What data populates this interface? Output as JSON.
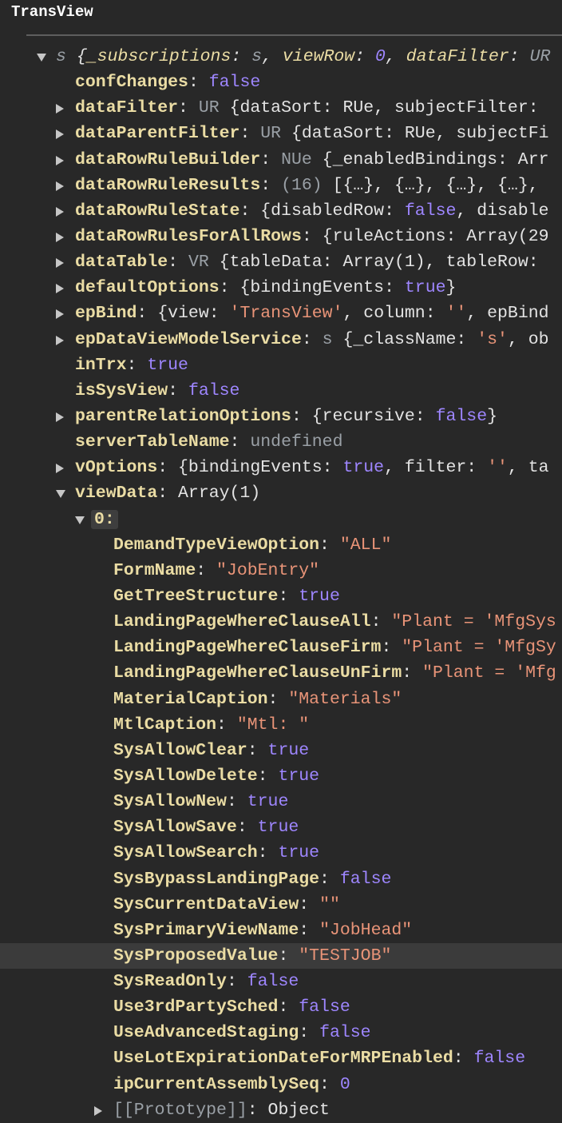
{
  "title": "TransView",
  "rows": [
    {
      "level": 0,
      "arrow": "d",
      "segs": [
        [
          "gi",
          "s "
        ],
        [
          "pi",
          "{"
        ],
        [
          "ik",
          "_subscriptions"
        ],
        [
          "pi",
          ": "
        ],
        [
          "gi",
          "s"
        ],
        [
          "pi",
          ", "
        ],
        [
          "ik",
          "viewRow"
        ],
        [
          "pi",
          ": "
        ],
        [
          "bi",
          "0"
        ],
        [
          "pi",
          ", "
        ],
        [
          "ik",
          "dataFilter"
        ],
        [
          "pi",
          ": "
        ],
        [
          "gi",
          "UR"
        ]
      ]
    },
    {
      "level": 1,
      "arrow": "",
      "segs": [
        [
          "k",
          "confChanges"
        ],
        [
          "p",
          ": "
        ],
        [
          "b",
          "false"
        ]
      ]
    },
    {
      "level": 1,
      "arrow": "r",
      "segs": [
        [
          "k",
          "dataFilter"
        ],
        [
          "p",
          ": "
        ],
        [
          "g",
          "UR "
        ],
        [
          "p",
          "{dataSort: RUe, subjectFilter: "
        ]
      ]
    },
    {
      "level": 1,
      "arrow": "r",
      "segs": [
        [
          "k",
          "dataParentFilter"
        ],
        [
          "p",
          ": "
        ],
        [
          "g",
          "UR "
        ],
        [
          "p",
          "{dataSort: RUe, subjectFi"
        ]
      ]
    },
    {
      "level": 1,
      "arrow": "r",
      "segs": [
        [
          "k",
          "dataRowRuleBuilder"
        ],
        [
          "p",
          ": "
        ],
        [
          "g",
          "NUe "
        ],
        [
          "p",
          "{_enabledBindings: Arr"
        ]
      ]
    },
    {
      "level": 1,
      "arrow": "r",
      "segs": [
        [
          "k",
          "dataRowRuleResults"
        ],
        [
          "p",
          ": "
        ],
        [
          "g",
          "(16) "
        ],
        [
          "p",
          "[{…}, {…}, {…}, {…}, "
        ]
      ]
    },
    {
      "level": 1,
      "arrow": "r",
      "segs": [
        [
          "k",
          "dataRowRuleState"
        ],
        [
          "p",
          ": {disabledRow: "
        ],
        [
          "b",
          "false"
        ],
        [
          "p",
          ", disable"
        ]
      ]
    },
    {
      "level": 1,
      "arrow": "r",
      "segs": [
        [
          "k",
          "dataRowRulesForAllRows"
        ],
        [
          "p",
          ": {ruleActions: Array(29"
        ]
      ]
    },
    {
      "level": 1,
      "arrow": "r",
      "segs": [
        [
          "k",
          "dataTable"
        ],
        [
          "p",
          ": "
        ],
        [
          "g",
          "VR "
        ],
        [
          "p",
          "{tableData: Array(1), tableRow: "
        ]
      ]
    },
    {
      "level": 1,
      "arrow": "r",
      "segs": [
        [
          "k",
          "defaultOptions"
        ],
        [
          "p",
          ": {bindingEvents: "
        ],
        [
          "b",
          "true"
        ],
        [
          "p",
          "}"
        ]
      ]
    },
    {
      "level": 1,
      "arrow": "r",
      "segs": [
        [
          "k",
          "epBind"
        ],
        [
          "p",
          ": {view: "
        ],
        [
          "s",
          "'TransView'"
        ],
        [
          "p",
          ", column: "
        ],
        [
          "s",
          "''"
        ],
        [
          "p",
          ", epBind"
        ]
      ]
    },
    {
      "level": 1,
      "arrow": "r",
      "segs": [
        [
          "k",
          "epDataViewModelService"
        ],
        [
          "p",
          ": "
        ],
        [
          "g",
          "s "
        ],
        [
          "p",
          "{_className: "
        ],
        [
          "s",
          "'s'"
        ],
        [
          "p",
          ", ob"
        ]
      ]
    },
    {
      "level": 1,
      "arrow": "",
      "segs": [
        [
          "k",
          "inTrx"
        ],
        [
          "p",
          ": "
        ],
        [
          "b",
          "true"
        ]
      ]
    },
    {
      "level": 1,
      "arrow": "",
      "segs": [
        [
          "k",
          "isSysView"
        ],
        [
          "p",
          ": "
        ],
        [
          "b",
          "false"
        ]
      ]
    },
    {
      "level": 1,
      "arrow": "r",
      "segs": [
        [
          "k",
          "parentRelationOptions"
        ],
        [
          "p",
          ": {recursive: "
        ],
        [
          "b",
          "false"
        ],
        [
          "p",
          "}"
        ]
      ]
    },
    {
      "level": 1,
      "arrow": "",
      "segs": [
        [
          "k",
          "serverTableName"
        ],
        [
          "p",
          ": "
        ],
        [
          "g",
          "undefined"
        ]
      ]
    },
    {
      "level": 1,
      "arrow": "r",
      "segs": [
        [
          "k",
          "vOptions"
        ],
        [
          "p",
          ": {bindingEvents: "
        ],
        [
          "b",
          "true"
        ],
        [
          "p",
          ", filter: "
        ],
        [
          "s",
          "''"
        ],
        [
          "p",
          ", ta"
        ]
      ]
    },
    {
      "level": 1,
      "arrow": "d",
      "segs": [
        [
          "k",
          "viewData"
        ],
        [
          "p",
          ": Array(1)"
        ]
      ]
    },
    {
      "level": 1.5,
      "arrow": "d",
      "segs": [
        [
          "k idx",
          "0:"
        ]
      ]
    },
    {
      "level": 2,
      "arrow": "",
      "segs": [
        [
          "k",
          "DemandTypeViewOption"
        ],
        [
          "p",
          ": "
        ],
        [
          "s",
          "\"ALL\""
        ]
      ]
    },
    {
      "level": 2,
      "arrow": "",
      "segs": [
        [
          "k",
          "FormName"
        ],
        [
          "p",
          ": "
        ],
        [
          "s",
          "\"JobEntry\""
        ]
      ]
    },
    {
      "level": 2,
      "arrow": "",
      "segs": [
        [
          "k",
          "GetTreeStructure"
        ],
        [
          "p",
          ": "
        ],
        [
          "b",
          "true"
        ]
      ]
    },
    {
      "level": 2,
      "arrow": "",
      "segs": [
        [
          "k",
          "LandingPageWhereClauseAll"
        ],
        [
          "p",
          ": "
        ],
        [
          "s",
          "\"Plant = 'MfgSys"
        ]
      ]
    },
    {
      "level": 2,
      "arrow": "",
      "segs": [
        [
          "k",
          "LandingPageWhereClauseFirm"
        ],
        [
          "p",
          ": "
        ],
        [
          "s",
          "\"Plant = 'MfgSy"
        ]
      ]
    },
    {
      "level": 2,
      "arrow": "",
      "segs": [
        [
          "k",
          "LandingPageWhereClauseUnFirm"
        ],
        [
          "p",
          ": "
        ],
        [
          "s",
          "\"Plant = 'Mfg"
        ]
      ]
    },
    {
      "level": 2,
      "arrow": "",
      "segs": [
        [
          "k",
          "MaterialCaption"
        ],
        [
          "p",
          ": "
        ],
        [
          "s",
          "\"Materials\""
        ]
      ]
    },
    {
      "level": 2,
      "arrow": "",
      "segs": [
        [
          "k",
          "MtlCaption"
        ],
        [
          "p",
          ": "
        ],
        [
          "s",
          "\"Mtl: \""
        ]
      ]
    },
    {
      "level": 2,
      "arrow": "",
      "segs": [
        [
          "k",
          "SysAllowClear"
        ],
        [
          "p",
          ": "
        ],
        [
          "b",
          "true"
        ]
      ]
    },
    {
      "level": 2,
      "arrow": "",
      "segs": [
        [
          "k",
          "SysAllowDelete"
        ],
        [
          "p",
          ": "
        ],
        [
          "b",
          "true"
        ]
      ]
    },
    {
      "level": 2,
      "arrow": "",
      "segs": [
        [
          "k",
          "SysAllowNew"
        ],
        [
          "p",
          ": "
        ],
        [
          "b",
          "true"
        ]
      ]
    },
    {
      "level": 2,
      "arrow": "",
      "segs": [
        [
          "k",
          "SysAllowSave"
        ],
        [
          "p",
          ": "
        ],
        [
          "b",
          "true"
        ]
      ]
    },
    {
      "level": 2,
      "arrow": "",
      "segs": [
        [
          "k",
          "SysAllowSearch"
        ],
        [
          "p",
          ": "
        ],
        [
          "b",
          "true"
        ]
      ]
    },
    {
      "level": 2,
      "arrow": "",
      "segs": [
        [
          "k",
          "SysBypassLandingPage"
        ],
        [
          "p",
          ": "
        ],
        [
          "b",
          "false"
        ]
      ]
    },
    {
      "level": 2,
      "arrow": "",
      "segs": [
        [
          "k",
          "SysCurrentDataView"
        ],
        [
          "p",
          ": "
        ],
        [
          "s",
          "\"\""
        ]
      ]
    },
    {
      "level": 2,
      "arrow": "",
      "segs": [
        [
          "k",
          "SysPrimaryViewName"
        ],
        [
          "p",
          ": "
        ],
        [
          "s",
          "\"JobHead\""
        ]
      ]
    },
    {
      "level": 2,
      "arrow": "",
      "highlight": true,
      "segs": [
        [
          "k",
          "SysProposedValue"
        ],
        [
          "p",
          ": "
        ],
        [
          "s",
          "\"TESTJOB\""
        ]
      ]
    },
    {
      "level": 2,
      "arrow": "",
      "segs": [
        [
          "k",
          "SysReadOnly"
        ],
        [
          "p",
          ": "
        ],
        [
          "b",
          "false"
        ]
      ]
    },
    {
      "level": 2,
      "arrow": "",
      "segs": [
        [
          "k",
          "Use3rdPartySched"
        ],
        [
          "p",
          ": "
        ],
        [
          "b",
          "false"
        ]
      ]
    },
    {
      "level": 2,
      "arrow": "",
      "segs": [
        [
          "k",
          "UseAdvancedStaging"
        ],
        [
          "p",
          ": "
        ],
        [
          "b",
          "false"
        ]
      ]
    },
    {
      "level": 2,
      "arrow": "",
      "segs": [
        [
          "k",
          "UseLotExpirationDateForMRPEnabled"
        ],
        [
          "p",
          ": "
        ],
        [
          "b",
          "false"
        ]
      ]
    },
    {
      "level": 2,
      "arrow": "",
      "segs": [
        [
          "k",
          "ipCurrentAssemblySeq"
        ],
        [
          "p",
          ": "
        ],
        [
          "b",
          "0"
        ]
      ]
    },
    {
      "level": 2,
      "arrow": "r",
      "segs": [
        [
          "g",
          "[[Prototype]]"
        ],
        [
          "p",
          ": Object"
        ]
      ]
    }
  ]
}
